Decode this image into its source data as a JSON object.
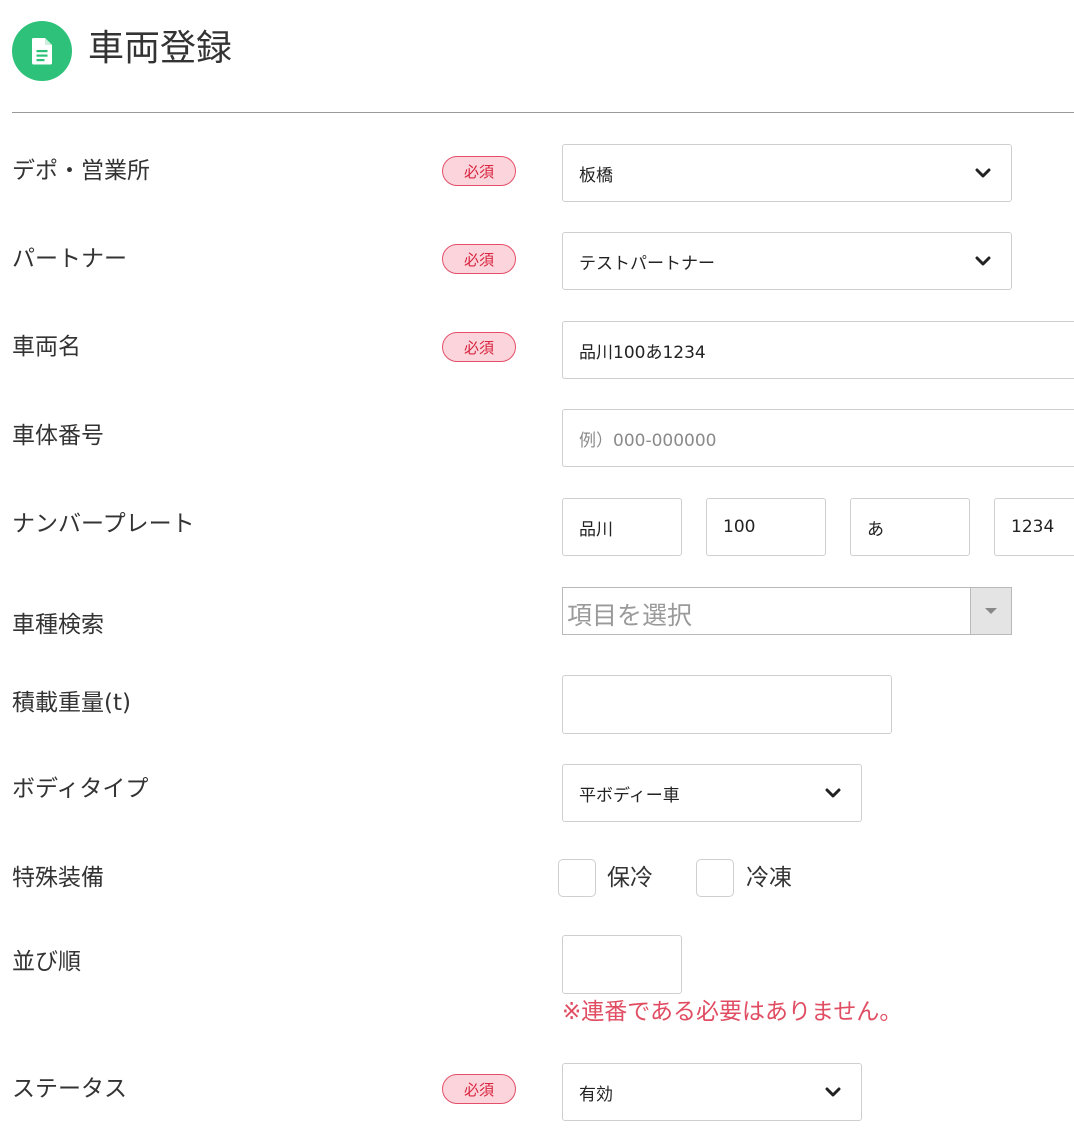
{
  "header": {
    "title": "車両登録",
    "icon": "document-icon",
    "icon_color": "#2ec17a"
  },
  "required_badge": "必須",
  "fields": {
    "depot": {
      "label": "デポ・営業所",
      "value": "板橋"
    },
    "partner": {
      "label": "パートナー",
      "value": "テストパートナー"
    },
    "vehicle_name": {
      "label": "車両名",
      "value": "品川100あ1234"
    },
    "chassis_number": {
      "label": "車体番号",
      "placeholder": "例）000-000000"
    },
    "number_plate": {
      "label": "ナンバープレート",
      "parts": [
        "品川",
        "100",
        "あ",
        "1234"
      ]
    },
    "vehicle_type_search": {
      "label": "車種検索",
      "placeholder": "項目を選択"
    },
    "load_capacity": {
      "label": "積載重量(t)",
      "value": ""
    },
    "body_type": {
      "label": "ボディタイプ",
      "value": "平ボディー車"
    },
    "special_equipment": {
      "label": "特殊装備",
      "options": [
        "保冷",
        "冷凍"
      ]
    },
    "sort_order": {
      "label": "並び順",
      "value": "",
      "note": "※連番である必要はありません。"
    },
    "status": {
      "label": "ステータス",
      "value": "有効"
    }
  },
  "colors": {
    "required_text": "#d8243f",
    "required_bg": "#fbd5db",
    "note": "#e04d62"
  }
}
